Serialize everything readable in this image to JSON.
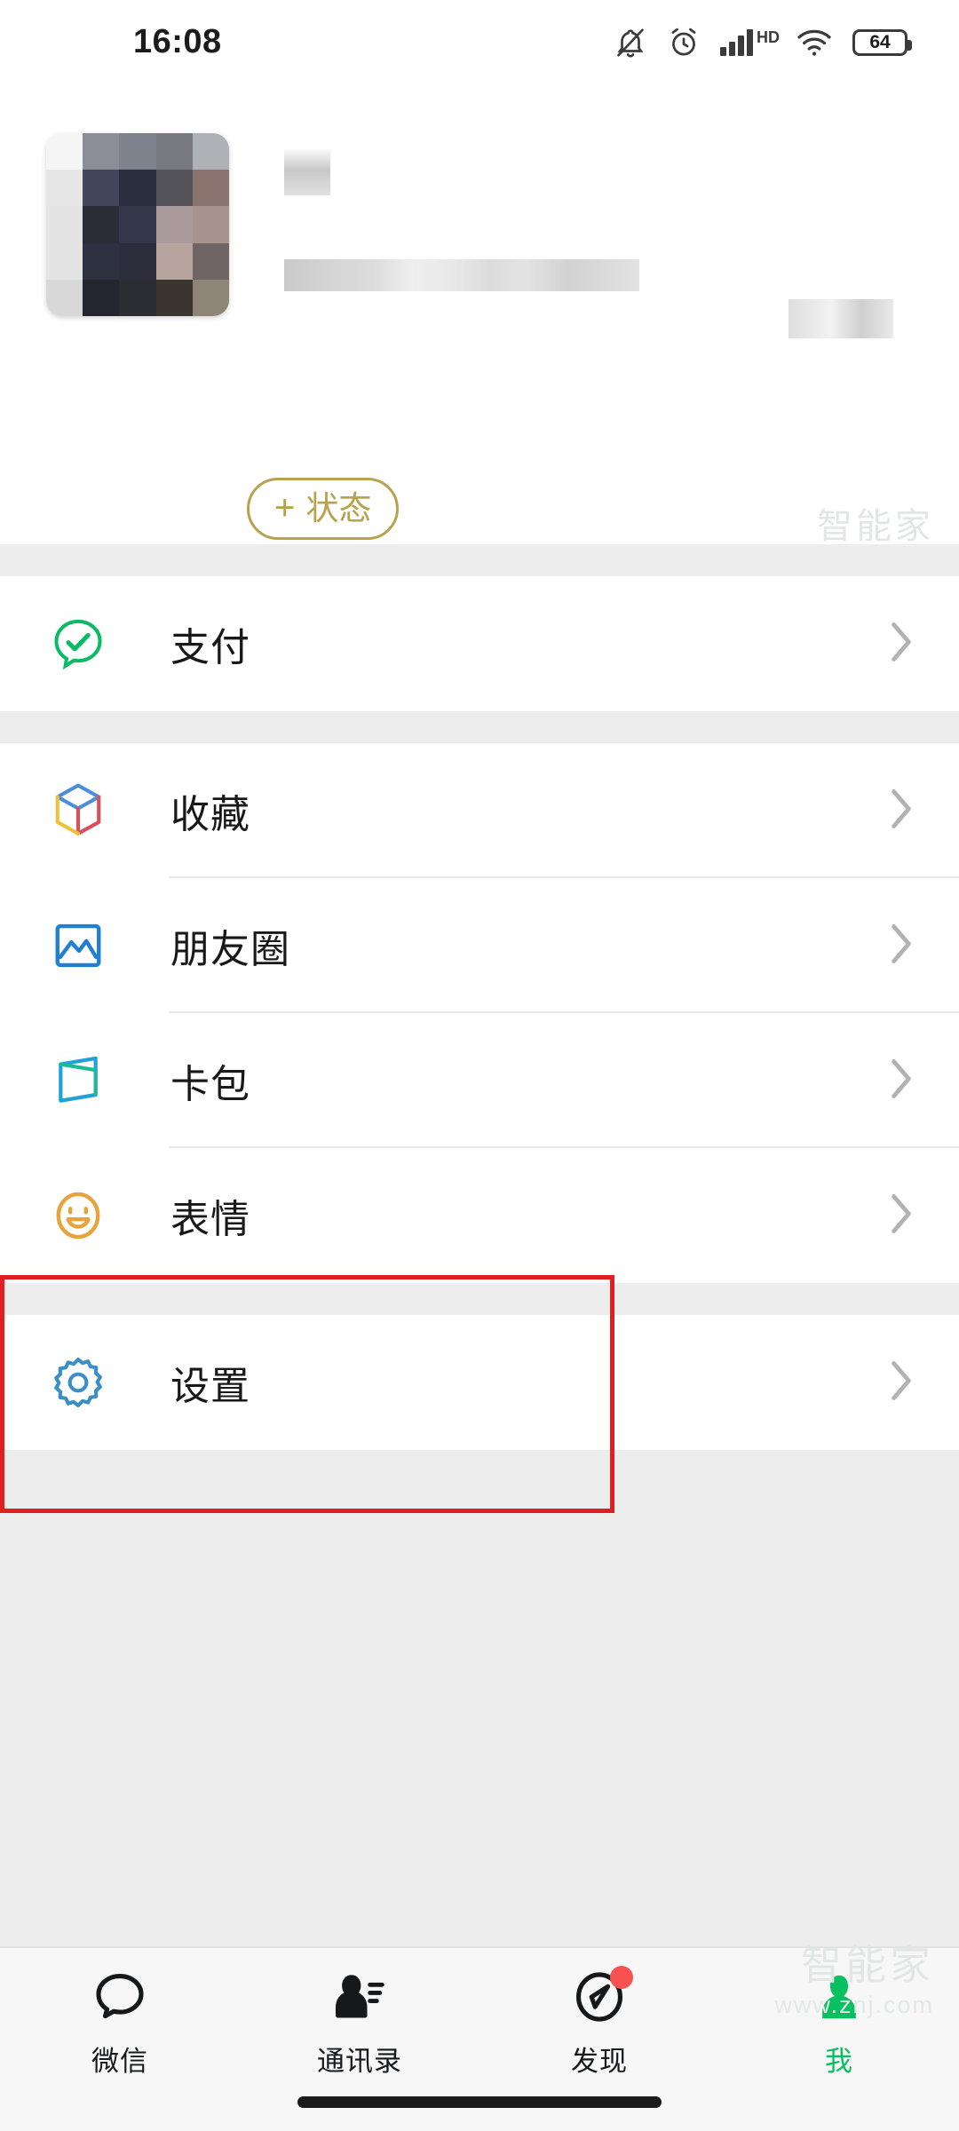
{
  "statusbar": {
    "time": "16:08",
    "hd_label": "HD",
    "battery_level": "64",
    "icons": [
      "bell-mute-icon",
      "alarm-clock-icon",
      "hd-signal-icon",
      "wifi-icon",
      "battery-icon"
    ]
  },
  "profile": {
    "name_redacted": "",
    "wechat_id_redacted": "",
    "status_button": {
      "plus": "+",
      "label": "状态"
    },
    "avatar_alt": "redacted-avatar",
    "avatar_mosaic": [
      "#f5f5f5",
      "#8b8e96",
      "#7e828c",
      "#787a80",
      "#aeb1b6",
      "#e6e6e6",
      "#43455a",
      "#2b2e3f",
      "#55535a",
      "#8b7470",
      "#e3e3e3",
      "#2b2c36",
      "#34374a",
      "#ab9a9c",
      "#a9938f",
      "#e3e3e3",
      "#2e3140",
      "#2b2d3a",
      "#b7a49f",
      "#6f6564",
      "#d8d8d8",
      "#24252f",
      "#2c2c33",
      "#3b352f",
      "#8e8576"
    ]
  },
  "groups": [
    {
      "name": "pay-group",
      "items": [
        {
          "label": "支付",
          "icon": "wechat-pay-icon",
          "accent": "#09bb62"
        }
      ]
    },
    {
      "name": "services-group",
      "items": [
        {
          "label": "收藏",
          "icon": "favorites-cube-icon",
          "accent": "#4a90d9"
        },
        {
          "label": "朋友圈",
          "icon": "moments-photo-icon",
          "accent": "#1f7fd0"
        },
        {
          "label": "卡包",
          "icon": "cards-wallet-icon",
          "accent": "#22a0d8"
        },
        {
          "label": "表情",
          "icon": "stickers-smiley-icon",
          "accent": "#e8a33d"
        }
      ]
    },
    {
      "name": "settings-group",
      "items": [
        {
          "label": "设置",
          "icon": "settings-gear-icon",
          "accent": "#3a8fc6"
        }
      ]
    }
  ],
  "annotation": {
    "color": "#e02020",
    "target": "设置"
  },
  "tabbar": {
    "tabs": [
      {
        "label": "微信",
        "icon": "chat-bubble-icon",
        "active": false,
        "badge": false
      },
      {
        "label": "通讯录",
        "icon": "contacts-icon",
        "active": false,
        "badge": false
      },
      {
        "label": "发现",
        "icon": "discover-compass-icon",
        "active": false,
        "badge": true
      },
      {
        "label": "我",
        "icon": "me-person-icon",
        "active": true,
        "badge": false
      }
    ],
    "active_color": "#07c160",
    "badge_color": "#fa5151"
  },
  "watermark": {
    "brand": "智能家",
    "url": "www.znj.com"
  }
}
